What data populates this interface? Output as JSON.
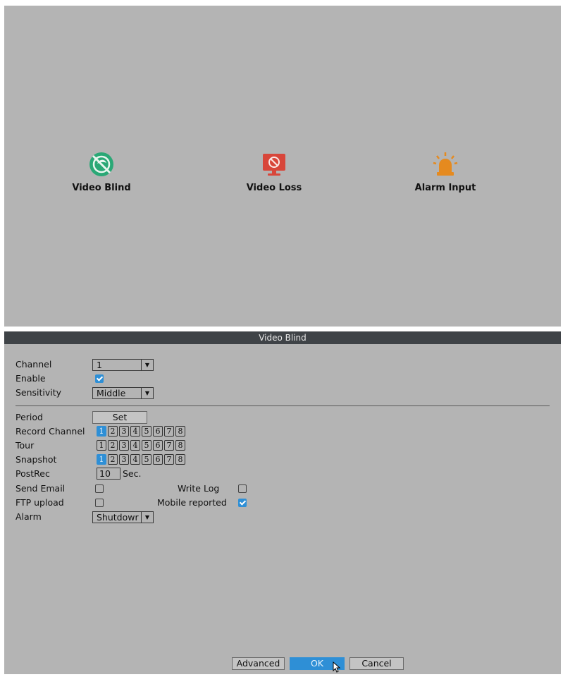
{
  "alarm_types": [
    {
      "label": "Video Blind",
      "icon": "video-blind-icon",
      "color": "#2aa876"
    },
    {
      "label": "Video Loss",
      "icon": "video-loss-icon",
      "color": "#d8463a"
    },
    {
      "label": "Alarm Input",
      "icon": "alarm-light-icon",
      "color": "#e58a1f"
    }
  ],
  "dialog": {
    "title": "Video Blind",
    "channel": {
      "label": "Channel",
      "value": "1"
    },
    "enable": {
      "label": "Enable",
      "checked": true
    },
    "sensitivity": {
      "label": "Sensitivity",
      "value": "Middle"
    },
    "period": {
      "label": "Period",
      "button": "Set"
    },
    "record_channel": {
      "label": "Record Channel",
      "channels": [
        "1",
        "2",
        "3",
        "4",
        "5",
        "6",
        "7",
        "8"
      ],
      "selected": [
        "1"
      ]
    },
    "tour": {
      "label": "Tour",
      "channels": [
        "1",
        "2",
        "3",
        "4",
        "5",
        "6",
        "7",
        "8"
      ],
      "selected": []
    },
    "snapshot": {
      "label": "Snapshot",
      "channels": [
        "1",
        "2",
        "3",
        "4",
        "5",
        "6",
        "7",
        "8"
      ],
      "selected": [
        "1"
      ]
    },
    "postrec": {
      "label": "PostRec",
      "value": "10",
      "unit": "Sec."
    },
    "send_email": {
      "label": "Send Email",
      "checked": false
    },
    "write_log": {
      "label": "Write Log",
      "checked": false
    },
    "ftp_upload": {
      "label": "FTP upload",
      "checked": false
    },
    "mobile_reported": {
      "label": "Mobile reported",
      "checked": true
    },
    "alarm": {
      "label": "Alarm",
      "value": "Shutdowr"
    },
    "buttons": {
      "advanced": "Advanced",
      "ok": "OK",
      "cancel": "Cancel"
    }
  },
  "colors": {
    "panel_bg": "#b4b4b4",
    "title_bar": "#3f4347",
    "accent": "#2e8fd6"
  }
}
